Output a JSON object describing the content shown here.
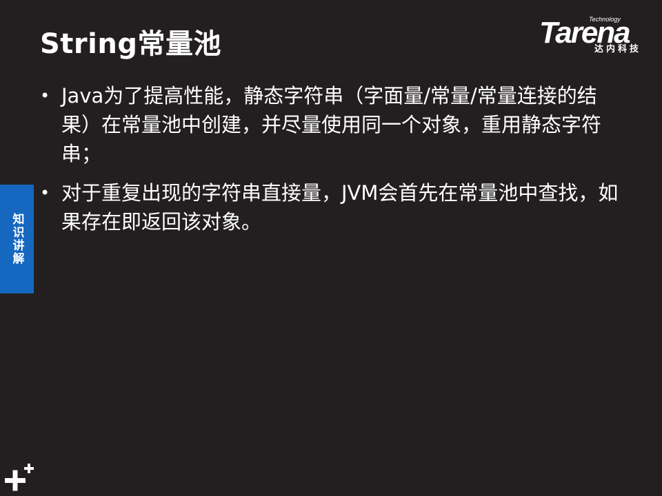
{
  "slide": {
    "title": "String常量池",
    "bullets": [
      {
        "symbol": "•",
        "text": "Java为了提高性能，静态字符串（字面量/常量/常量连接的结果）在常量池中创建，并尽量使用同一个对象，重用静态字符串；"
      },
      {
        "symbol": "•",
        "text": "对于重复出现的字符串直接量，JVM会首先在常量池中查找，如果存在即返回该对象。"
      }
    ]
  },
  "logo": {
    "brand": "Tarena",
    "tagline": "Technology",
    "cn_name": "达内科技"
  },
  "side_tab": {
    "label": "知识讲解",
    "color": "#1567c0"
  },
  "colors": {
    "background": "#231f20",
    "text": "#ffffff"
  },
  "icons": {
    "corner": "plus-plus-icon"
  }
}
